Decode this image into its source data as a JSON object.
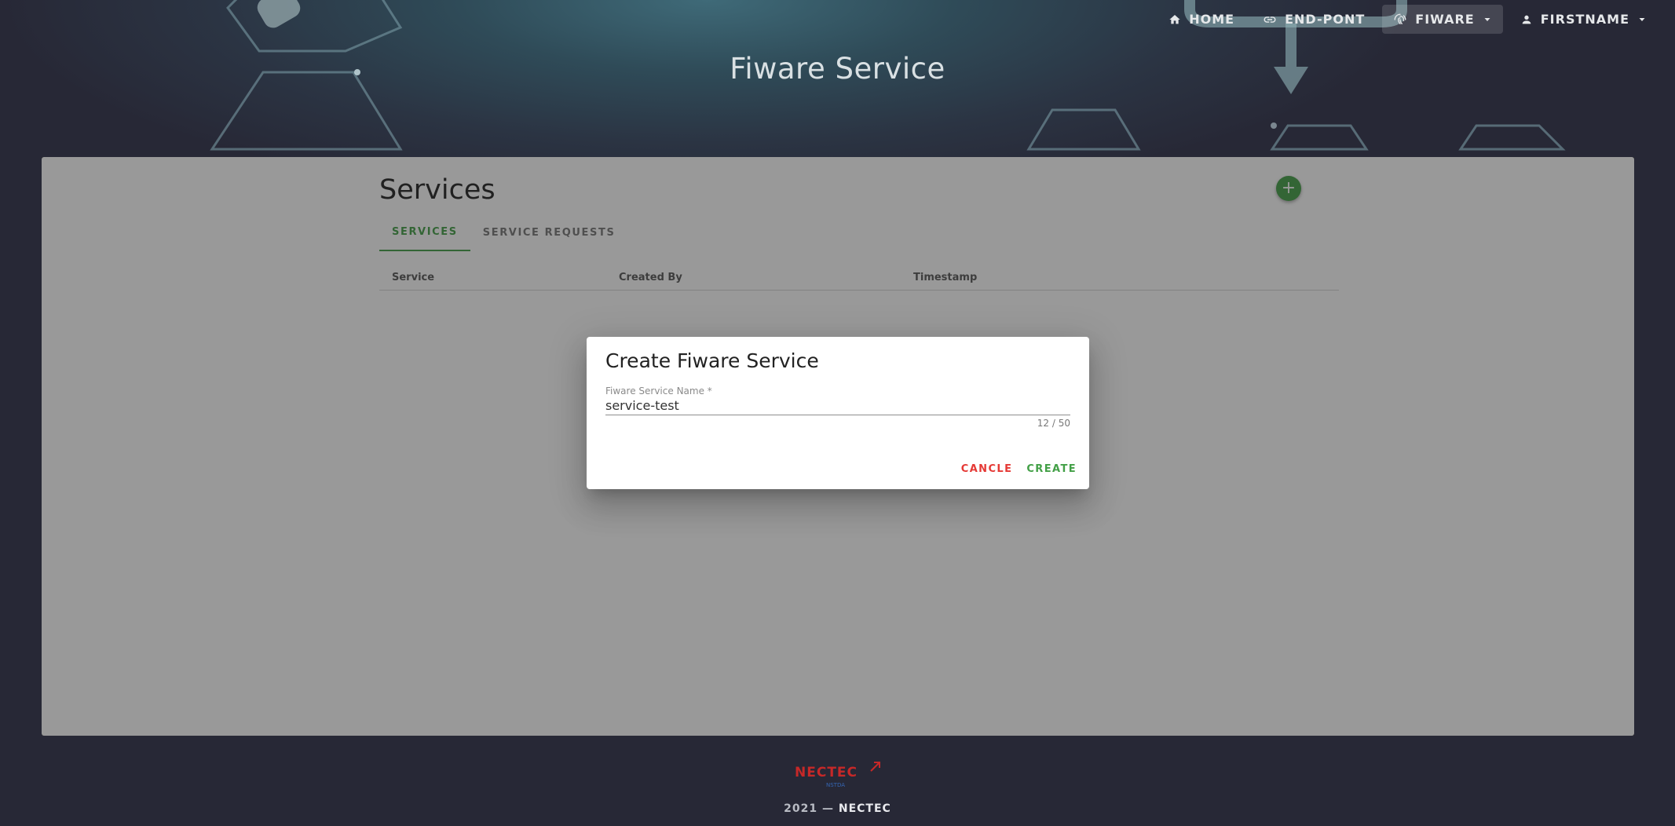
{
  "header": {
    "page_title": "Fiware Service",
    "nav": {
      "home": "HOME",
      "endpoint": "END-PONT",
      "fiware": "FIWARE",
      "user": "FIRSTNAME"
    }
  },
  "main": {
    "title": "Services",
    "tabs": [
      {
        "label": "SERVICES",
        "active": true
      },
      {
        "label": "SERVICE REQUESTS",
        "active": false
      }
    ],
    "columns": [
      "Service",
      "Created By",
      "Timestamp"
    ],
    "add_button": "+"
  },
  "dialog": {
    "title": "Create Fiware Service",
    "field_label": "Fiware Service Name *",
    "field_value": "service-test",
    "counter": "12 / 50",
    "cancel": "CANCLE",
    "create": "CREATE"
  },
  "footer": {
    "logo_text": "NECTEC",
    "logo_sub": "NSTDA",
    "year": "2021 —",
    "org": "NECTEC"
  },
  "colors": {
    "accent": "#43a047",
    "cancel": "#e53935",
    "background": "#272836"
  }
}
